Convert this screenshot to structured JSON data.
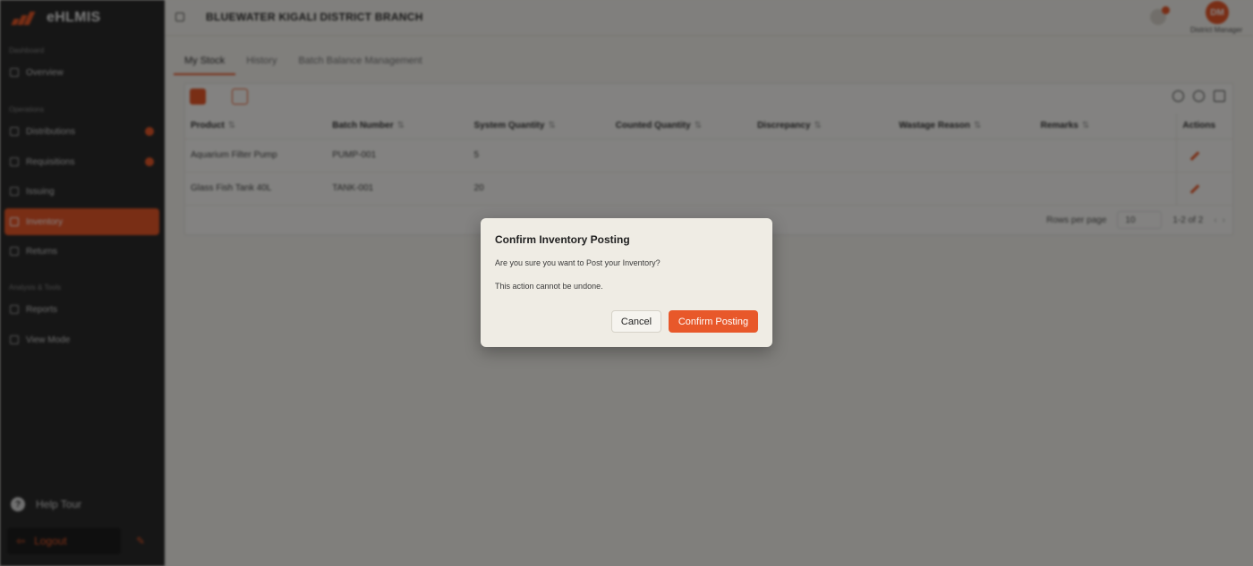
{
  "app": {
    "name": "eHLMIS"
  },
  "sidebar": {
    "sections": [
      {
        "label": "Dashboard"
      },
      {
        "label": "Operations"
      },
      {
        "label": "Analysis & Tools"
      }
    ],
    "items": [
      {
        "label": "Overview"
      },
      {
        "label": "Distributions"
      },
      {
        "label": "Requisitions"
      },
      {
        "label": "Issuing"
      },
      {
        "label": "Inventory"
      },
      {
        "label": "Returns"
      },
      {
        "label": "Reports"
      },
      {
        "label": "View Mode"
      }
    ],
    "help_label": "Help Tour",
    "logout_label": "Logout"
  },
  "header": {
    "branch": "BLUEWATER KIGALI DISTRICT BRANCH",
    "avatar_initials": "DM",
    "role": "District Manager"
  },
  "tabs": [
    {
      "label": "My Stock"
    },
    {
      "label": "History"
    },
    {
      "label": "Batch Balance Management"
    }
  ],
  "table": {
    "columns": [
      "Product",
      "Batch Number",
      "System Quantity",
      "Counted Quantity",
      "Discrepancy",
      "Wastage Reason",
      "Remarks",
      "Actions"
    ],
    "rows": [
      {
        "product": "Aquarium Filter Pump",
        "batch": "PUMP-001",
        "system_qty": "5"
      },
      {
        "product": "Glass Fish Tank 40L",
        "batch": "TANK-001",
        "system_qty": "20"
      }
    ],
    "rows_per_page_label": "Rows per page",
    "rows_per_page": "10",
    "range": "1-2 of 2"
  },
  "modal": {
    "title": "Confirm Inventory Posting",
    "message": "Are you sure you want to Post your Inventory?",
    "warning": "This action cannot be undone.",
    "cancel_label": "Cancel",
    "confirm_label": "Confirm Posting"
  },
  "colors": {
    "accent": "#e8582a",
    "sidebar": "#2b2b2b",
    "modal_bg": "#efece4"
  }
}
